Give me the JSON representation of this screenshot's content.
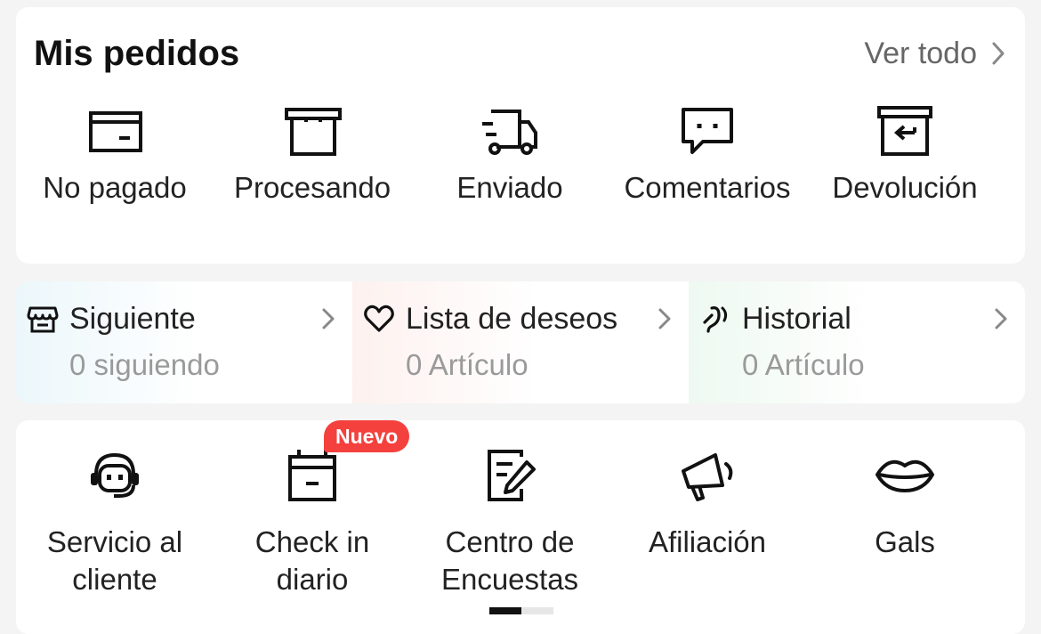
{
  "orders": {
    "title": "Mis pedidos",
    "view_all": "Ver todo",
    "items": [
      {
        "label": "No pagado",
        "icon": "wallet-icon"
      },
      {
        "label": "Procesando",
        "icon": "box-icon"
      },
      {
        "label": "Enviado",
        "icon": "truck-icon"
      },
      {
        "label": "Comentarios",
        "icon": "comment-icon"
      },
      {
        "label": "Devolución",
        "icon": "return-icon"
      }
    ]
  },
  "quick": {
    "items": [
      {
        "title": "Siguiente",
        "subtitle": "0 siguiendo",
        "icon": "store-icon"
      },
      {
        "title": "Lista de deseos",
        "subtitle": "0 Artículo",
        "icon": "heart-icon"
      },
      {
        "title": "Historial",
        "subtitle": "0 Artículo",
        "icon": "footprint-icon"
      }
    ]
  },
  "services": {
    "badge": "Nuevo",
    "items": [
      {
        "label": "Servicio al cliente",
        "icon": "headset-icon"
      },
      {
        "label": "Check in diario",
        "icon": "calendar-icon"
      },
      {
        "label": "Centro de Encuestas",
        "icon": "survey-icon"
      },
      {
        "label": "Afiliación",
        "icon": "megaphone-icon"
      },
      {
        "label": "Gals",
        "icon": "lips-icon"
      }
    ],
    "pager": {
      "pages": 2,
      "active": 1
    }
  },
  "colors": {
    "accent": "#f4413d",
    "text": "#222222",
    "muted": "#9a9a9a",
    "background": "#f4f4f4",
    "card": "#ffffff"
  }
}
